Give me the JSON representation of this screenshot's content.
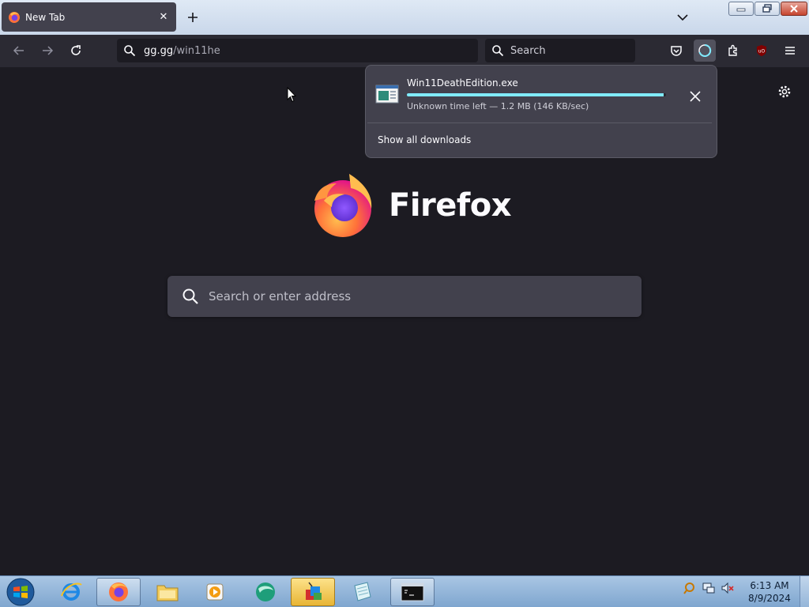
{
  "browser": {
    "tab": {
      "title": "New Tab"
    },
    "url": {
      "host": "gg.gg",
      "path": "/win11he"
    },
    "search": {
      "placeholder": "Search"
    }
  },
  "downloads": {
    "filename": "Win11DeathEdition.exe",
    "status": "Unknown time left — 1.2 MB (146 KB/sec)",
    "progress": 0.99,
    "show_all": "Show all downloads"
  },
  "newtab": {
    "wordmark": "Firefox",
    "search_placeholder": "Search or enter address"
  },
  "taskbar": {
    "time": "6:13 AM",
    "date": "8/9/2024"
  },
  "colors": {
    "accent": "#80ebff",
    "background": "#1c1b22",
    "toolbar": "#2b2a33"
  }
}
